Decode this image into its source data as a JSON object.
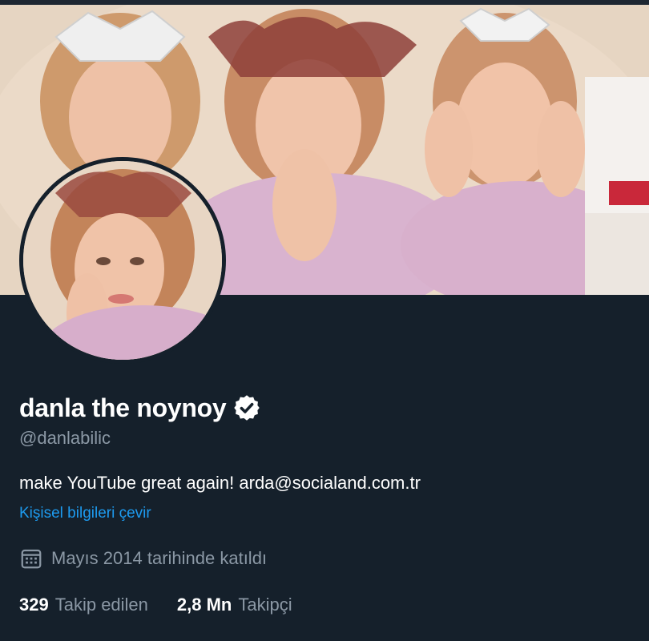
{
  "profile": {
    "display_name": "danla the noynoy",
    "handle": "@danlabilic",
    "bio": "make YouTube great again! arda@socialand.com.tr",
    "translate_label": "Kişisel bilgileri çevir",
    "joined": "Mayıs 2014 tarihinde katıldı"
  },
  "stats": {
    "following_count": "329",
    "following_label": "Takip edilen",
    "followers_count": "2,8 Mn",
    "followers_label": "Takipçi"
  },
  "icons": {
    "verified": "verified-badge-icon",
    "calendar": "calendar-icon"
  },
  "colors": {
    "background": "#15202b",
    "text_primary": "#ffffff",
    "text_secondary": "#8b98a5",
    "link": "#1d9bf0"
  }
}
